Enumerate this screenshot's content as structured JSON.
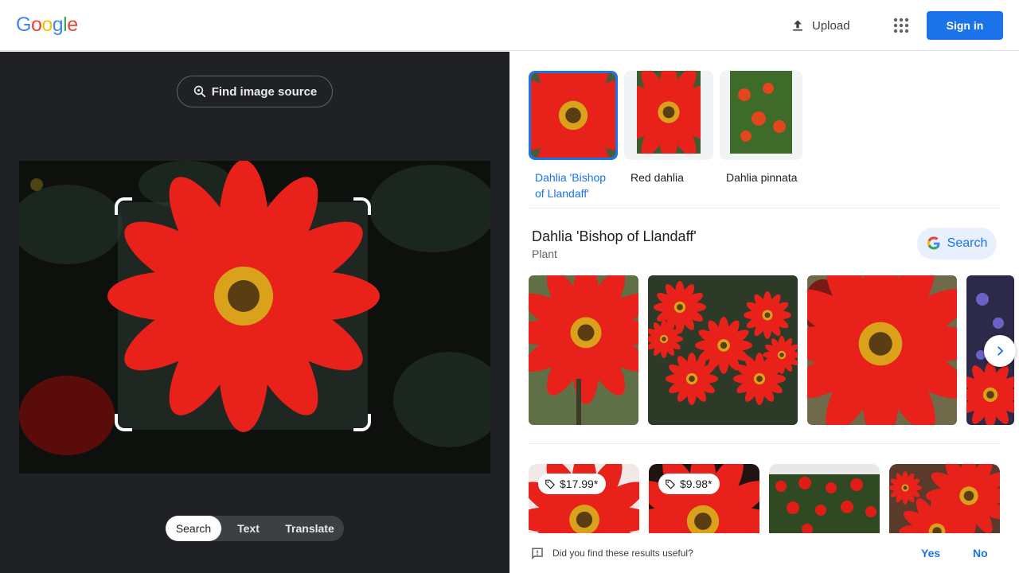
{
  "header": {
    "logo_letters": [
      {
        "ch": "G",
        "color": "#4285F4"
      },
      {
        "ch": "o",
        "color": "#EA4335"
      },
      {
        "ch": "o",
        "color": "#FBBC05"
      },
      {
        "ch": "g",
        "color": "#4285F4"
      },
      {
        "ch": "l",
        "color": "#34A853"
      },
      {
        "ch": "e",
        "color": "#EA4335"
      }
    ],
    "upload_label": "Upload",
    "signin_label": "Sign in",
    "accent": "#1a73e8"
  },
  "lens": {
    "find_source_label": "Find image source",
    "modes": [
      "Search",
      "Text",
      "Translate"
    ],
    "active_mode": "Search"
  },
  "results": {
    "chips": [
      {
        "label": "Dahlia 'Bishop of Llandaff'",
        "selected": true
      },
      {
        "label": "Red dahlia",
        "selected": false
      },
      {
        "label": "Dahlia pinnata",
        "selected": false
      }
    ],
    "knowledge": {
      "title": "Dahlia 'Bishop of Llandaff'",
      "subtitle": "Plant",
      "search_label": "Search"
    },
    "products": [
      {
        "price": "$17.99*"
      },
      {
        "price": "$9.98*"
      }
    ],
    "feedback": {
      "question": "Did you find these results useful?",
      "yes": "Yes",
      "no": "No"
    }
  }
}
